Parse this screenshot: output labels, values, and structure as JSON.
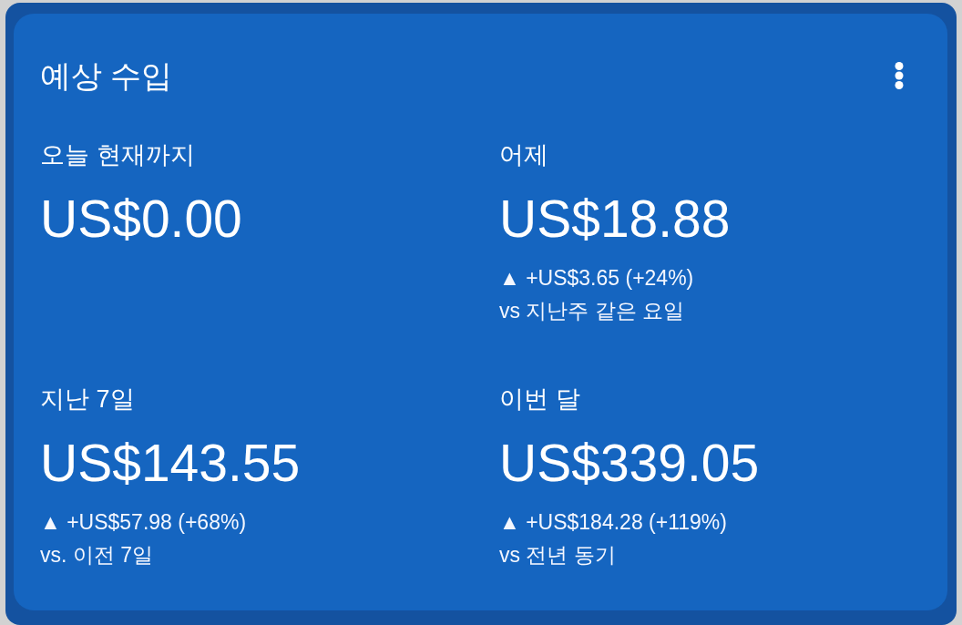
{
  "card": {
    "title": "예상 수입"
  },
  "metrics": [
    {
      "label": "오늘 현재까지",
      "value": "US$0.00"
    },
    {
      "label": "어제",
      "value": "US$18.88",
      "change": "▲ +US$3.65 (+24%)",
      "comparison": "vs 지난주 같은 요일"
    },
    {
      "label": "지난 7일",
      "value": "US$143.55",
      "change": "▲ +US$57.98 (+68%)",
      "comparison": "vs. 이전 7일"
    },
    {
      "label": "이번 달",
      "value": "US$339.05",
      "change": "▲ +US$184.28 (+119%)",
      "comparison": "vs 전년 동기"
    }
  ]
}
